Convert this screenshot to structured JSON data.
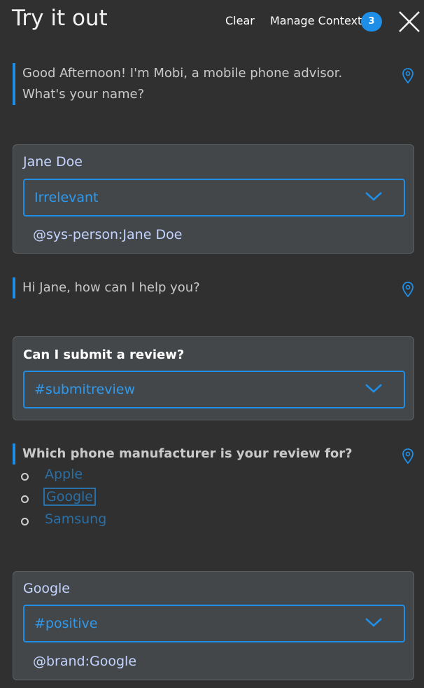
{
  "header": {
    "title": "Try it out",
    "clear_label": "Clear",
    "manage_context_label": "Manage Context",
    "context_count": "3"
  },
  "messages": {
    "bot_1_line1": "Good Afternoon! I'm Mobi, a mobile phone advisor.",
    "bot_1_line2": "What's your name?",
    "user_1": {
      "text": "Jane Doe",
      "intent": "Irrelevant",
      "entity": "@sys-person:Jane Doe"
    },
    "bot_2": "Hi Jane, how can I help you?",
    "user_2": {
      "text": "Can I submit a review?",
      "intent": "#submitreview"
    },
    "bot_3": "Which phone manufacturer is your review for?",
    "options": [
      "Apple",
      "Google",
      "Samsung"
    ],
    "user_3": {
      "text": "Google",
      "intent": "#positive",
      "entity": "@brand:Google"
    }
  },
  "colors": {
    "background": "#303030",
    "accent": "#1f8ee6",
    "card": "#43474a"
  },
  "icons": [
    "close-icon",
    "location-pin-icon",
    "chevron-down-icon"
  ]
}
